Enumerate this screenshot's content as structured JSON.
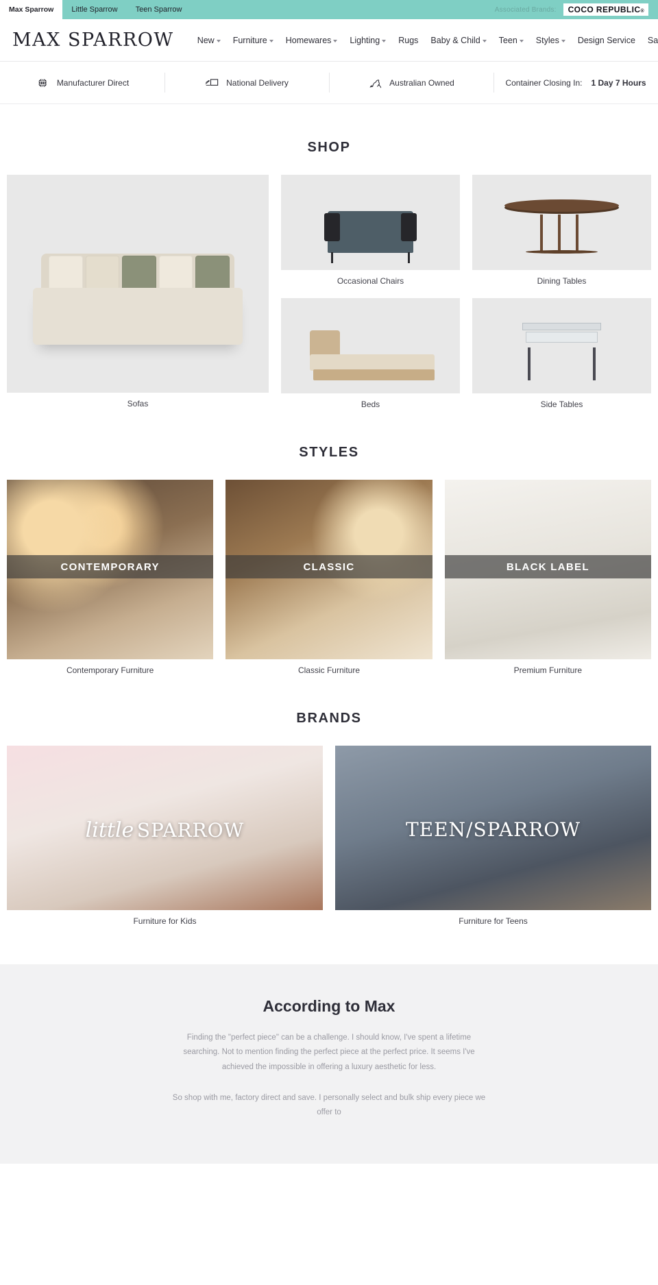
{
  "topbar": {
    "tabs": [
      {
        "label": "Max Sparrow",
        "active": true
      },
      {
        "label": "Little Sparrow",
        "active": false
      },
      {
        "label": "Teen Sparrow",
        "active": false
      }
    ],
    "associated_label": "Associated Brands:",
    "associated_brand": "COCO REPUBLIC",
    "associated_brand_mark": "®",
    "accent_color": "#7fcfc4"
  },
  "nav": {
    "logo": "MAX SPARROW",
    "links": [
      {
        "label": "New",
        "dropdown": true
      },
      {
        "label": "Furniture",
        "dropdown": true
      },
      {
        "label": "Homewares",
        "dropdown": true
      },
      {
        "label": "Lighting",
        "dropdown": true
      },
      {
        "label": "Rugs",
        "dropdown": false
      },
      {
        "label": "Baby & Child",
        "dropdown": true
      },
      {
        "label": "Teen",
        "dropdown": true
      },
      {
        "label": "Styles",
        "dropdown": true
      },
      {
        "label": "Design Service",
        "dropdown": false
      },
      {
        "label": "Sale",
        "dropdown": false
      }
    ],
    "search_icon": "search-icon",
    "cart_icon": "cart-icon"
  },
  "trustbar": [
    {
      "icon": "globe-icon",
      "label": "Manufacturer Direct"
    },
    {
      "icon": "delivery-truck-icon",
      "label": "National Delivery"
    },
    {
      "icon": "kangaroo-icon",
      "label": "Australian Owned"
    },
    {
      "icon": "",
      "label": "Container Closing In:",
      "value": "1 Day 7 Hours"
    }
  ],
  "shop": {
    "title": "SHOP",
    "tiles": [
      {
        "label": "Sofas",
        "art": "sofa"
      },
      {
        "label": "Occasional Chairs",
        "art": "chair"
      },
      {
        "label": "Dining Tables",
        "art": "table"
      },
      {
        "label": "Beds",
        "art": "bed"
      },
      {
        "label": "Side Tables",
        "art": "side-table"
      }
    ]
  },
  "styles": {
    "title": "STYLES",
    "cards": [
      {
        "overlay": "CONTEMPORARY",
        "label": "Contemporary Furniture"
      },
      {
        "overlay": "CLASSIC",
        "label": "Classic Furniture"
      },
      {
        "overlay": "BLACK LABEL",
        "label": "Premium Furniture"
      }
    ]
  },
  "brands": {
    "title": "BRANDS",
    "cards": [
      {
        "script": "little",
        "caps": "SPARROW",
        "label": "Furniture for Kids"
      },
      {
        "script": "",
        "caps": "TEEN/SPARROW",
        "label": "Furniture for Teens"
      }
    ]
  },
  "according_to_max": {
    "title": "According to Max",
    "paragraph_1": "Finding the \"perfect piece\" can be a challenge. I should know, I've spent a lifetime searching. Not to mention finding the perfect piece at the perfect price. It seems I've achieved the impossible in offering a luxury aesthetic for less.",
    "paragraph_2": "So shop with me, factory direct and save. I personally select and bulk ship every piece we offer to"
  }
}
